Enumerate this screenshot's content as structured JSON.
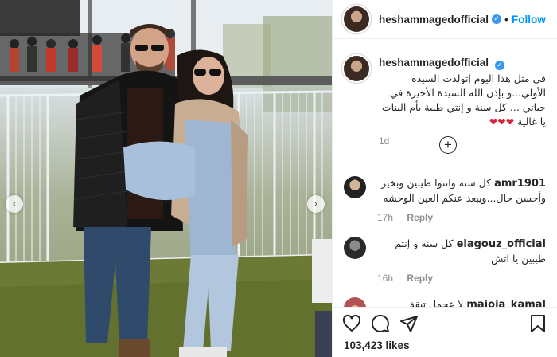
{
  "post": {
    "username": "heshammagedofficial",
    "follow_label": "Follow",
    "caption_text": "في مثل هذا اليوم إتولدت السيدة الأولي...و بإذن الله السيدة الأخيرة في حياتي ... كل سنة و إنتي طيبة يأم البنات يا غالية",
    "caption_hearts": "❤❤❤",
    "caption_time": "1d",
    "likes_text": "103,423 likes"
  },
  "comments": [
    {
      "username": "amr1901",
      "text": "كل سنه وانتوا طيبين وبخير وأحسن حال...ويبعد عنكم العين الوحشه",
      "time": "17h",
      "reply_label": "Reply"
    },
    {
      "username": "elagouz_official",
      "text": "كل سنه و إنتم طيبين يا اتش",
      "time": "16h",
      "reply_label": "Reply"
    },
    {
      "username": "majoja_kamal",
      "text": "لا عحمل تبقة",
      "time": "",
      "reply_label": ""
    }
  ],
  "icons": {
    "verified": "verified-badge-icon",
    "like": "heart-icon",
    "comment": "comment-icon",
    "share": "share-icon",
    "save": "bookmark-icon",
    "load_more": "plus-circle-icon",
    "prev": "chevron-left-icon",
    "next": "chevron-right-icon"
  },
  "colors": {
    "accent": "#0095f6",
    "verified": "#3897f0",
    "muted": "#8e8e8e",
    "heart": "#d6243a"
  }
}
